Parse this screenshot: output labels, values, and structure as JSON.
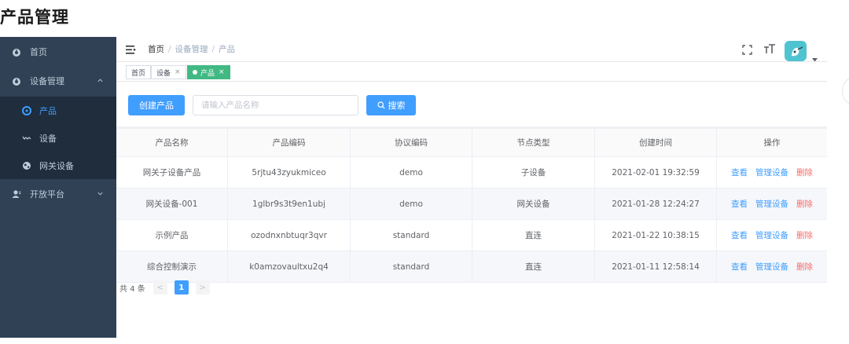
{
  "page_title": "产品管理",
  "sidebar": {
    "items": [
      {
        "label": "首页",
        "icon": "dashboard-icon"
      },
      {
        "label": "设备管理",
        "icon": "dashboard-icon",
        "expanded": true,
        "children": [
          {
            "label": "产品",
            "icon": "product-icon",
            "active": true
          },
          {
            "label": "设备",
            "icon": "device-icon"
          },
          {
            "label": "网关设备",
            "icon": "globe-icon"
          }
        ]
      },
      {
        "label": "开放平台",
        "icon": "user-icon"
      }
    ]
  },
  "navbar": {
    "breadcrumb": [
      "首页",
      "设备管理",
      "产品"
    ]
  },
  "tags": [
    {
      "label": "首页"
    },
    {
      "label": "设备",
      "closable": true
    },
    {
      "label": "产品",
      "closable": true,
      "active": true
    }
  ],
  "toolbar": {
    "create_label": "创建产品",
    "search_placeholder": "请输入产品名称",
    "search_label": "搜索"
  },
  "table": {
    "columns": [
      "产品名称",
      "产品编码",
      "协议编码",
      "节点类型",
      "创建时间",
      "操作"
    ],
    "rows": [
      {
        "name": "网关子设备产品",
        "code": "5rjtu43zyukmiceo",
        "protocol": "demo",
        "node_type": "子设备",
        "created": "2021-02-01 19:32:59"
      },
      {
        "name": "网关设备-001",
        "code": "1glbr9s3t9en1ubj",
        "protocol": "demo",
        "node_type": "网关设备",
        "created": "2021-01-28 12:24:27"
      },
      {
        "name": "示例产品",
        "code": "ozodnxnbtuqr3qvr",
        "protocol": "standard",
        "node_type": "直连",
        "created": "2021-01-22 10:38:15"
      },
      {
        "name": "综合控制演示",
        "code": "k0amzovaultxu2q4",
        "protocol": "standard",
        "node_type": "直连",
        "created": "2021-01-11 12:58:14"
      }
    ],
    "actions": {
      "view": "查看",
      "manage": "管理设备",
      "delete": "删除"
    }
  },
  "pagination": {
    "total_label": "共 4 条",
    "current_page": "1",
    "prev": "<",
    "next": ">"
  },
  "colors": {
    "sidebar_bg": "#304156",
    "submenu_bg": "#1f2d3d",
    "primary": "#409eff",
    "tag_active": "#42b983",
    "danger": "#f56c6c"
  }
}
